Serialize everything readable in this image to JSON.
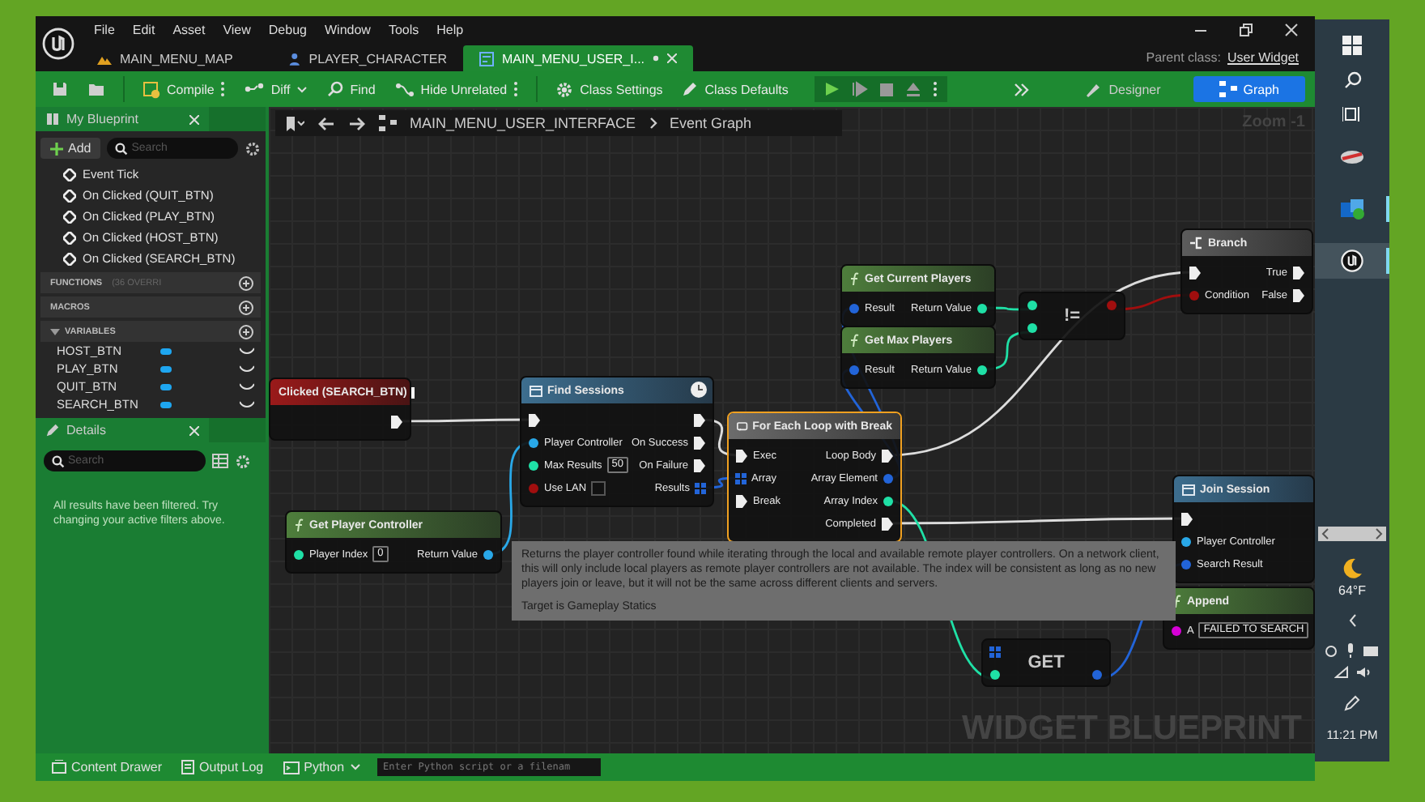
{
  "window": {
    "menu": [
      "File",
      "Edit",
      "Asset",
      "View",
      "Debug",
      "Window",
      "Tools",
      "Help"
    ],
    "tabs": [
      {
        "label": "MAIN_MENU_MAP",
        "kind": "level",
        "selected": false,
        "modified": false
      },
      {
        "label": "PLAYER_CHARACTER",
        "kind": "blueprint",
        "selected": false,
        "modified": false
      },
      {
        "label": "MAIN_MENU_USER_I...",
        "kind": "widget",
        "selected": true,
        "modified": true
      }
    ],
    "parent_class": {
      "label": "Parent class:",
      "value": "User Widget"
    }
  },
  "toolbar": {
    "buttons": [
      {
        "kind": "save",
        "more": false,
        "dropdown": false
      },
      {
        "kind": "browse",
        "more": false,
        "dropdown": false
      },
      {
        "kind": "compile",
        "label": "Compile",
        "more": true,
        "dropdown": false
      },
      {
        "kind": "diff",
        "label": "Diff",
        "more": false,
        "dropdown": true
      },
      {
        "kind": "find",
        "label": "Find",
        "more": false,
        "dropdown": false
      },
      {
        "kind": "hide",
        "label": "Hide Unrelated",
        "more": true,
        "dropdown": false
      },
      {
        "kind": "settings",
        "label": "Class Settings",
        "more": false,
        "dropdown": false
      },
      {
        "kind": "defaults",
        "label": "Class Defaults",
        "more": false,
        "dropdown": false
      }
    ],
    "modes": [
      {
        "label": "Designer",
        "selected": false
      },
      {
        "label": "Graph",
        "selected": true
      }
    ]
  },
  "my_blueprint": {
    "title": "My Blueprint",
    "add": "Add",
    "search_placeholder": "Search",
    "events": [
      "Event Tick",
      "On Clicked (QUIT_BTN)",
      "On Clicked (PLAY_BTN)",
      "On Clicked (HOST_BTN)",
      "On Clicked (SEARCH_BTN)"
    ],
    "sections": [
      {
        "label": "FUNCTIONS",
        "note": "(36 OVERRI",
        "expanded": false
      },
      {
        "label": "MACROS",
        "expanded": false
      },
      {
        "label": "VARIABLES",
        "expanded": true
      }
    ],
    "variables": [
      "HOST_BTN",
      "PLAY_BTN",
      "QUIT_BTN",
      "SEARCH_BTN"
    ]
  },
  "details": {
    "title": "Details",
    "search_placeholder": "Search",
    "message": "All results have been filtered. Try changing your active filters above."
  },
  "graph": {
    "breadcrumb": [
      "MAIN_MENU_USER_INTERFACE",
      "Event Graph"
    ],
    "zoom": "Zoom -1",
    "nodes": [
      {
        "kind": "event",
        "title": "Clicked (SEARCH_BTN)",
        "selected": false,
        "latent": false,
        "rows": [
          {
            "out": {
              "kind": "exec"
            }
          }
        ]
      },
      {
        "kind": "function",
        "title": "Find Sessions",
        "selected": false,
        "latent": true,
        "rows": [
          {
            "in": {
              "kind": "exec"
            },
            "out": {
              "kind": "exec"
            }
          },
          {
            "in": {
              "label": "Player Controller",
              "kind": "object"
            },
            "out": {
              "label": "On Success",
              "kind": "exec"
            }
          },
          {
            "in": {
              "label": "Max Results",
              "kind": "int",
              "value": "50"
            },
            "out": {
              "label": "On Failure",
              "kind": "exec"
            }
          },
          {
            "in": {
              "label": "Use LAN",
              "kind": "bool",
              "checked": false
            },
            "out": {
              "label": "Results",
              "kind": "array"
            }
          }
        ]
      },
      {
        "kind": "macro",
        "title": "For Each Loop with Break",
        "selected": true,
        "latent": false,
        "rows": [
          {
            "in": {
              "label": "Exec",
              "kind": "exec"
            },
            "out": {
              "label": "Loop Body",
              "kind": "exec"
            }
          },
          {
            "in": {
              "label": "Array",
              "kind": "array"
            },
            "out": {
              "label": "Array Element",
              "kind": "struct"
            }
          },
          {
            "in": {
              "label": "Break",
              "kind": "exec"
            },
            "out": {
              "label": "Array Index",
              "kind": "int"
            }
          },
          {
            "out": {
              "label": "Completed",
              "kind": "exec"
            }
          }
        ]
      },
      {
        "kind": "pure",
        "title": "Get Current Players",
        "selected": false,
        "latent": false,
        "rows": [
          {
            "in": {
              "label": "Result",
              "kind": "struct"
            },
            "out": {
              "label": "Return Value",
              "kind": "int"
            }
          }
        ]
      },
      {
        "kind": "pure",
        "title": "Get Max Players",
        "selected": false,
        "latent": false,
        "rows": [
          {
            "in": {
              "label": "Result",
              "kind": "struct"
            },
            "out": {
              "label": "Return Value",
              "kind": "int"
            }
          }
        ]
      },
      {
        "kind": "compact",
        "symbol": "!=",
        "selected": false,
        "latent": false,
        "rows": [
          {
            "in": {
              "kind": "int"
            },
            "out": {
              "kind": "bool"
            }
          },
          {
            "in": {
              "kind": "int"
            }
          }
        ]
      },
      {
        "kind": "branch",
        "title": "Branch",
        "selected": false,
        "latent": false,
        "rows": [
          {
            "in": {
              "kind": "exec"
            },
            "out": {
              "label": "True",
              "kind": "exec"
            }
          },
          {
            "in": {
              "label": "Condition",
              "kind": "bool"
            },
            "out": {
              "label": "False",
              "kind": "exec"
            }
          }
        ]
      },
      {
        "kind": "function",
        "title": "Join Session",
        "selected": false,
        "latent": false,
        "rows": [
          {
            "in": {
              "kind": "exec"
            }
          },
          {
            "in": {
              "label": "Player Controller",
              "kind": "object"
            }
          },
          {
            "in": {
              "label": "Search Result",
              "kind": "struct"
            }
          }
        ]
      },
      {
        "kind": "pure",
        "title": "Get Player Controller",
        "selected": false,
        "latent": false,
        "rows": [
          {
            "in": {
              "label": "Player Index",
              "kind": "int",
              "value": "0"
            },
            "out": {
              "label": "Return Value",
              "kind": "object"
            }
          }
        ]
      },
      {
        "kind": "compact",
        "symbol": "GET",
        "selected": false,
        "latent": false,
        "rows": [
          {
            "in": {
              "kind": "array"
            }
          },
          {
            "in": {
              "kind": "int"
            },
            "out": {
              "kind": "struct"
            }
          }
        ]
      },
      {
        "kind": "pure",
        "title": "Append",
        "selected": false,
        "latent": false,
        "rows": [
          {
            "in": {
              "label": "A",
              "kind": "string",
              "value": "FAILED TO SEARCH"
            }
          }
        ]
      }
    ],
    "tooltip": {
      "text": "Returns the player controller found while iterating through the local and available remote player controllers. On a network client, this will only include local players as remote player controllers are not available. The index will be consistent as long as no new players join or leave, but it will not be the same across different clients and servers.",
      "target": "Target is Gameplay Statics"
    },
    "watermark": "WIDGET BLUEPRINT"
  },
  "status_bar": {
    "items": [
      {
        "kind": "drawer",
        "label": "Content Drawer"
      },
      {
        "kind": "log",
        "label": "Output Log"
      }
    ],
    "console": "Python",
    "placeholder": "Enter Python script or a filenam"
  },
  "taskbar": {
    "apps": [
      {
        "running": false,
        "selected": false
      },
      {
        "running": true,
        "selected": false
      },
      {
        "running": true,
        "selected": true
      }
    ],
    "weather": "64°F",
    "time": "11:21 PM"
  }
}
